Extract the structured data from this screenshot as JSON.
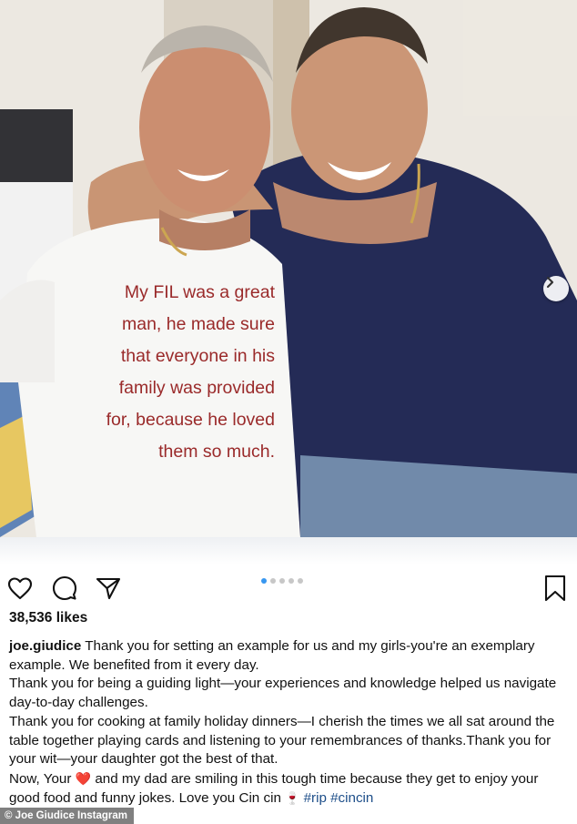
{
  "post": {
    "image_text": [
      "My FIL was a great",
      "man, he made sure",
      "that everyone in his",
      "family was provided",
      "for, because he loved",
      "them so much."
    ],
    "carousel": {
      "count": 5,
      "active_index": 0
    },
    "likes": "38,536 likes",
    "caption": {
      "username": "joe.giudice",
      "lines": {
        "p1": "Thank you for setting an example for us and my girls-you're an exemplary example. We benefited from it every day.",
        "p2": "Thank you for being a guiding light—your experiences and knowledge helped us navigate day-to-day challenges.",
        "p3": "Thank you for cooking at family holiday dinners—I cherish the times we all sat around the table together playing cards and listening to your remembrances of thanks.Thank you for your wit—your daughter got the best of that.",
        "p4_start": "Now, Your",
        "p4_end": "and my dad are smiling in this tough time because they get to enjoy your good food and funny jokes. Love you Cin cin",
        "hashtags": "#rip #cincin"
      },
      "heart_emoji": "❤️",
      "wine_emoji": "🍷"
    }
  },
  "credit": "© Joe Giudice Instagram",
  "icons": {
    "like": "heart-icon",
    "comment": "comment-icon",
    "share": "send-icon",
    "save": "bookmark-icon",
    "next": "chevron-right-icon"
  },
  "colors": {
    "accent_dot": "#3897f0",
    "overlay_text": "#9a2a2a",
    "hashtag": "#1d4e89"
  }
}
